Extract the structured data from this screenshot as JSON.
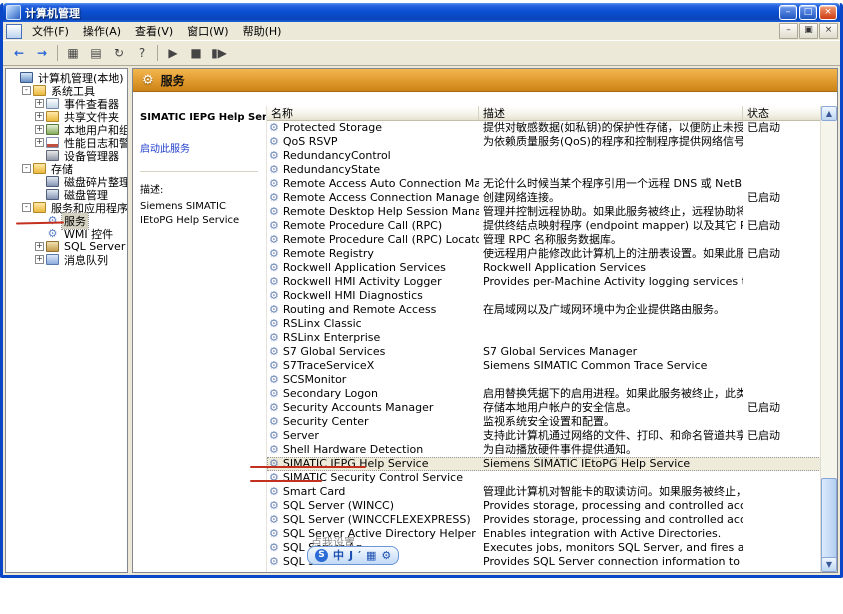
{
  "window": {
    "title": "计算机管理"
  },
  "title_controls": {
    "minimize": "–",
    "maximize": "□",
    "close": "×"
  },
  "menu_bar": {
    "items": [
      "文件(F)",
      "操作(A)",
      "查看(V)",
      "窗口(W)",
      "帮助(H)"
    ]
  },
  "mdi_controls": {
    "minimize": "–",
    "restore": "▣",
    "close": "×"
  },
  "toolbar": {
    "icons": [
      {
        "name": "back-icon",
        "glyph": "←",
        "blue": true
      },
      {
        "name": "forward-icon",
        "glyph": "→",
        "blue": true
      },
      {
        "name": "separator"
      },
      {
        "name": "show-console-tree-icon",
        "glyph": "▦"
      },
      {
        "name": "properties-icon",
        "glyph": "▤"
      },
      {
        "name": "refresh-icon",
        "glyph": "↻"
      },
      {
        "name": "help-icon",
        "glyph": "?"
      },
      {
        "name": "separator"
      },
      {
        "name": "start-service-icon",
        "glyph": "▶"
      },
      {
        "name": "stop-service-icon",
        "glyph": "■"
      },
      {
        "name": "restart-service-icon",
        "glyph": "▮▶"
      }
    ]
  },
  "tree": {
    "items": [
      {
        "label": "计算机管理(本地)",
        "level": 0,
        "icon": "computer",
        "expander": ""
      },
      {
        "label": "系统工具",
        "level": 1,
        "icon": "folder-tools",
        "expander": "-"
      },
      {
        "label": "事件查看器",
        "level": 2,
        "icon": "event-log",
        "expander": "+"
      },
      {
        "label": "共享文件夹",
        "level": 2,
        "icon": "shared-folder",
        "expander": "+"
      },
      {
        "label": "本地用户和组",
        "level": 2,
        "icon": "users",
        "expander": "+"
      },
      {
        "label": "性能日志和警报",
        "level": 2,
        "icon": "perf",
        "expander": "+"
      },
      {
        "label": "设备管理器",
        "level": 2,
        "icon": "device",
        "expander": ""
      },
      {
        "label": "存储",
        "level": 1,
        "icon": "folder",
        "expander": "-"
      },
      {
        "label": "磁盘碎片整理程序",
        "level": 2,
        "icon": "defrag",
        "expander": ""
      },
      {
        "label": "磁盘管理",
        "level": 2,
        "icon": "disk",
        "expander": ""
      },
      {
        "label": "服务和应用程序",
        "level": 1,
        "icon": "folder-apps",
        "expander": "-"
      },
      {
        "label": "服务",
        "level": 2,
        "icon": "gear",
        "expander": "",
        "selected": true
      },
      {
        "label": "WMI 控件",
        "level": 2,
        "icon": "gear",
        "expander": ""
      },
      {
        "label": "SQL Server Configurati",
        "level": 2,
        "icon": "sql",
        "expander": "+"
      },
      {
        "label": "消息队列",
        "level": 2,
        "icon": "queue",
        "expander": "+"
      }
    ]
  },
  "content_header": {
    "title": "服务"
  },
  "side_panel": {
    "service_name": "SIMATIC IEPG Help Service",
    "start_link": "启动此服务",
    "description_label": "描述:",
    "description": "Siemens SIMATIC IEtoPG Help Service"
  },
  "services": {
    "columns": [
      "名称",
      "描述",
      "状态"
    ],
    "rows": [
      {
        "name": "Protected Storage",
        "desc": "提供对敏感数据(如私钥)的保护性存储，以便防止未授权的服务，过程或用户对其的...",
        "status": "已启动"
      },
      {
        "name": "QoS RSVP",
        "desc": "为依赖质量服务(QoS)的程序和控制程序提供网络信号和本地通信控制安装功能。",
        "status": ""
      },
      {
        "name": "RedundancyControl",
        "desc": "",
        "status": ""
      },
      {
        "name": "RedundancyState",
        "desc": "",
        "status": ""
      },
      {
        "name": "Remote Access Auto Connection Manager",
        "desc": "无论什么时候当某个程序引用一个远程 DNS 或 NetBIOS 名或者地址时就创建一个到远...",
        "status": ""
      },
      {
        "name": "Remote Access Connection Manager",
        "desc": "创建网络连接。",
        "status": "已启动"
      },
      {
        "name": "Remote Desktop Help Session Manager",
        "desc": "管理并控制远程协助。如果此服务被终止，远程协助将不可用。终止此服务前，请参...",
        "status": ""
      },
      {
        "name": "Remote Procedure Call (RPC)",
        "desc": "提供终结点映射程序 (endpoint mapper) 以及其它 RPC 服务。",
        "status": "已启动"
      },
      {
        "name": "Remote Procedure Call (RPC) Locator",
        "desc": "管理 RPC 名称服务数据库。",
        "status": ""
      },
      {
        "name": "Remote Registry",
        "desc": "使远程用户能修改此计算机上的注册表设置。如果此服务被终止，只有此计算机上...",
        "status": "已启动"
      },
      {
        "name": "Rockwell Application Services",
        "desc": "Rockwell Application Services",
        "status": ""
      },
      {
        "name": "Rockwell HMI Activity Logger",
        "desc": "Provides per-Machine Activity logging services to RSView Enterprise",
        "status": ""
      },
      {
        "name": "Rockwell HMI Diagnostics",
        "desc": "",
        "status": ""
      },
      {
        "name": "Routing and Remote Access",
        "desc": "在局域网以及广域网环境中为企业提供路由服务。",
        "status": ""
      },
      {
        "name": "RSLinx Classic",
        "desc": "",
        "status": ""
      },
      {
        "name": "RSLinx Enterprise",
        "desc": "",
        "status": ""
      },
      {
        "name": "S7 Global Services",
        "desc": "S7 Global Services Manager",
        "status": ""
      },
      {
        "name": "S7TraceServiceX",
        "desc": "Siemens SIMATIC Common Trace Service",
        "status": ""
      },
      {
        "name": "SCSMonitor",
        "desc": "",
        "status": ""
      },
      {
        "name": "Secondary Logon",
        "desc": "启用替换凭据下的启用进程。如果此服务被终止，此类型登录访问将不可用。如果此...",
        "status": ""
      },
      {
        "name": "Security Accounts Manager",
        "desc": "存储本地用户帐户的安全信息。",
        "status": "已启动"
      },
      {
        "name": "Security Center",
        "desc": "监视系统安全设置和配置。",
        "status": ""
      },
      {
        "name": "Server",
        "desc": "支持此计算机通过网络的文件、打印、和命名管道共享。如果服务停止，这些功能不...",
        "status": "已启动"
      },
      {
        "name": "Shell Hardware Detection",
        "desc": "为自动播放硬件事件提供通知。",
        "status": ""
      },
      {
        "name": "SIMATIC IEPG Help Service",
        "desc": "Siemens SIMATIC IEtoPG Help Service",
        "status": "",
        "selected": true
      },
      {
        "name": "SIMATIC Security Control Service",
        "desc": "",
        "status": ""
      },
      {
        "name": "Smart Card",
        "desc": "管理此计算机对智能卡的取读访问。如果服务被终止，此计算机将无法取读智能卡...",
        "status": ""
      },
      {
        "name": "SQL Server (WINCC)",
        "desc": "Provides storage, processing and controlled access of data and rapid trans...",
        "status": ""
      },
      {
        "name": "SQL Server (WINCCFLEXEXPRESS)",
        "desc": "Provides storage, processing and controlled access of data and rapid trans...",
        "status": ""
      },
      {
        "name": "SQL Server Active Directory Helper",
        "desc": "Enables integration with Active Directories.",
        "status": ""
      },
      {
        "name": "SQL Server Ag",
        "desc": "Executes jobs, monitors SQL Server, and fires alerts, and allows automatic...",
        "status": ""
      },
      {
        "name": "SQL Server Br",
        "desc": "Provides SQL Server connection information to client computers.",
        "status": ""
      }
    ]
  },
  "scrollbar": {
    "up": "▲",
    "down": "▼"
  },
  "ime": {
    "hint": "点我设置",
    "items": [
      {
        "name": "ime-logo",
        "glyph": "S"
      },
      {
        "name": "ime-chinese-mode-icon",
        "glyph": "中"
      },
      {
        "name": "ime-pen-icon",
        "glyph": "J"
      },
      {
        "name": "ime-punctuation-icon",
        "glyph": "′"
      },
      {
        "name": "ime-softkeyboard-icon",
        "glyph": "▦"
      },
      {
        "name": "ime-settings-icon",
        "glyph": "⚙"
      }
    ]
  },
  "icons": {
    "service_gear": "⚙",
    "band_gear": "⚙"
  },
  "colors": {
    "titlebar_blue": "#0A46C8",
    "band_orange": "#E09A2E",
    "annotation_red": "#C43020",
    "started_text": "#000000"
  }
}
